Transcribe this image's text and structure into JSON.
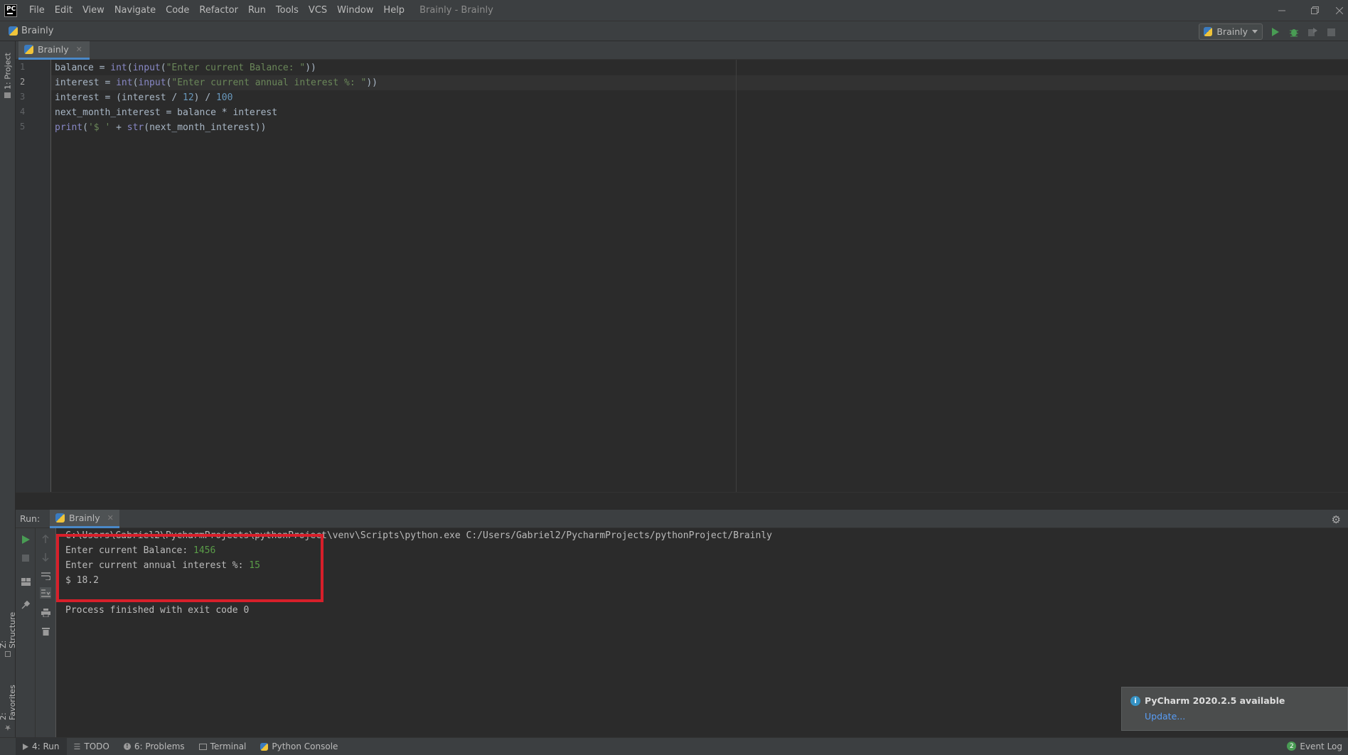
{
  "menubar": {
    "logo": "PC",
    "items": [
      "File",
      "Edit",
      "View",
      "Navigate",
      "Code",
      "Refactor",
      "Run",
      "Tools",
      "VCS",
      "Window",
      "Help"
    ],
    "window_title": "Brainly - Brainly"
  },
  "navbar": {
    "breadcrumb": "Brainly",
    "run_config": "Brainly"
  },
  "left_strip": {
    "project": "1: Project",
    "structure": "Z: Structure",
    "favorites": "2: Favorites"
  },
  "editor": {
    "tab_label": "Brainly",
    "line_numbers": [
      "1",
      "2",
      "3",
      "4",
      "5"
    ],
    "lines": [
      [
        {
          "t": "balance = ",
          "c": ""
        },
        {
          "t": "int",
          "c": "fn"
        },
        {
          "t": "(",
          "c": ""
        },
        {
          "t": "input",
          "c": "fn"
        },
        {
          "t": "(",
          "c": ""
        },
        {
          "t": "\"Enter current Balance: \"",
          "c": "str"
        },
        {
          "t": "))",
          "c": ""
        }
      ],
      [
        {
          "t": "interest = ",
          "c": ""
        },
        {
          "t": "int",
          "c": "fn"
        },
        {
          "t": "(",
          "c": ""
        },
        {
          "t": "input",
          "c": "fn"
        },
        {
          "t": "(",
          "c": ""
        },
        {
          "t": "\"Enter current annual interest %: \"",
          "c": "str"
        },
        {
          "t": "))",
          "c": ""
        }
      ],
      [
        {
          "t": "interest = (interest / ",
          "c": ""
        },
        {
          "t": "12",
          "c": "num"
        },
        {
          "t": ") / ",
          "c": ""
        },
        {
          "t": "100",
          "c": "num"
        }
      ],
      [
        {
          "t": "next_month_interest = balance * interest",
          "c": ""
        }
      ],
      [
        {
          "t": "print",
          "c": "fn"
        },
        {
          "t": "(",
          "c": ""
        },
        {
          "t": "'$ '",
          "c": "str"
        },
        {
          "t": " + ",
          "c": ""
        },
        {
          "t": "str",
          "c": "fn"
        },
        {
          "t": "(next_month_interest))",
          "c": ""
        }
      ]
    ]
  },
  "run_panel": {
    "label": "Run:",
    "tab_label": "Brainly",
    "console": {
      "command": "C:\\Users\\Gabriel2\\PycharmProjects\\pythonProject\\venv\\Scripts\\python.exe C:/Users/Gabriel2/PycharmProjects/pythonProject/Brainly",
      "prompt1": "Enter current Balance: ",
      "input1": "1456",
      "prompt2": "Enter current annual interest %: ",
      "input2": "15",
      "result": "$ 18.2",
      "exit": "Process finished with exit code 0"
    }
  },
  "notification": {
    "title": "PyCharm 2020.2.5 available",
    "link": "Update..."
  },
  "statusbar": {
    "run": "4: Run",
    "todo": "TODO",
    "problems": "6: Problems",
    "terminal": "Terminal",
    "python_console": "Python Console",
    "event_log": "Event Log",
    "event_count": "2"
  },
  "colors": {
    "accent": "#4a88c7",
    "highlight_box": "#d71f2a",
    "run_green": "#499c54",
    "console_input": "#5a9c48"
  }
}
